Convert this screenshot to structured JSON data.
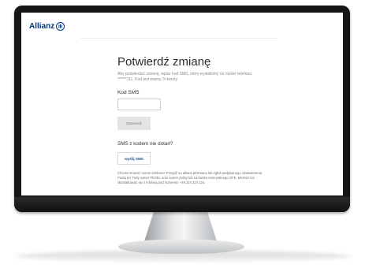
{
  "brand": {
    "name": "Allianz"
  },
  "page": {
    "title": "Potwierdź zmianę",
    "description": "Aby potwierdzić zmianę, wpisz kod SMS, który wysłaliśmy na numer telefonu: ******111. Kod jest ważny 3 minuty.",
    "sms_field_label": "Kod SMS",
    "sms_input_value": "",
    "confirm_label": "Zatwierdź",
    "not_received_label": "SMS z kodem nie dotarł?",
    "resend_label": "wyślij SMS",
    "note": "Chcesz zmienić numer telefonu? Przejdź na allianz.pl/zmiana lub zgłoś podpisanego oświadczenia. Podaj też Twój numer PESEL oraz numer polisy lub rachunku emerytalnego OFE. Możesz też skontaktować się z infolinią pod numerem +48 224 224 224."
  },
  "colors": {
    "brand": "#003781",
    "bezel": "#151617"
  }
}
